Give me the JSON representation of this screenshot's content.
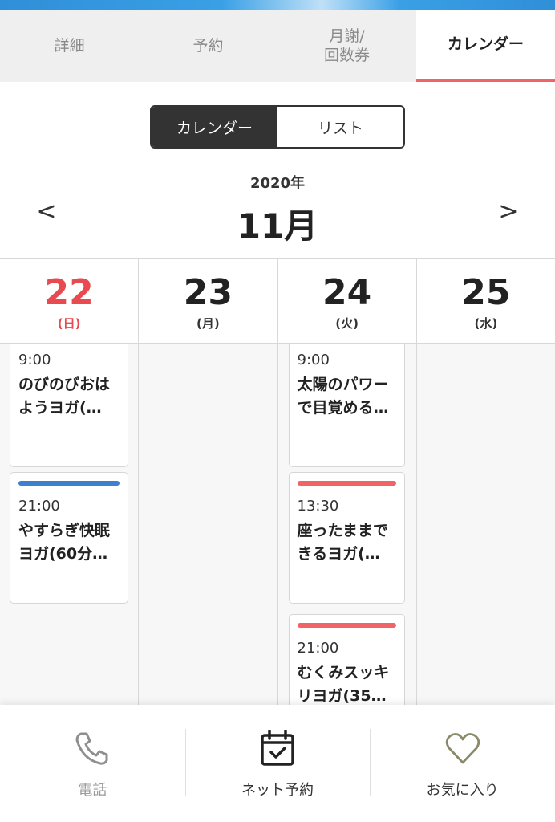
{
  "tabs": [
    {
      "line1": "詳細",
      "line2": ""
    },
    {
      "line1": "予約",
      "line2": ""
    },
    {
      "line1": "月謝/",
      "line2": "回数券"
    },
    {
      "line1": "カレンダー",
      "line2": ""
    }
  ],
  "view_toggle": {
    "calendar": "カレンダー",
    "list": "リスト"
  },
  "calendar": {
    "year": "2020年",
    "month": "11月",
    "prev": "<",
    "next": ">",
    "days": [
      {
        "num": "22",
        "weekday": "(日)"
      },
      {
        "num": "23",
        "weekday": "(月)"
      },
      {
        "num": "24",
        "weekday": "(火)"
      },
      {
        "num": "25",
        "weekday": "(水)"
      }
    ],
    "events": {
      "day22": [
        {
          "time": "9:00",
          "name": "のびのびおはようヨガ(…"
        },
        {
          "time": "21:00",
          "name": "やすらぎ快眠ヨガ(60分…",
          "bar_color": "#3f7fcf"
        }
      ],
      "day24": [
        {
          "time": "9:00",
          "name": "太陽のパワーで目覚める…"
        },
        {
          "time": "13:30",
          "name": "座ったままできるヨガ(…",
          "bar_color": "#f06468"
        },
        {
          "time": "21:00",
          "name": "むくみスッキリヨガ(35…",
          "bar_color": "#f06468"
        }
      ]
    }
  },
  "bottom_nav": {
    "phone": "電話",
    "booking": "ネット予約",
    "favorite": "お気に入り"
  },
  "colors": {
    "accent": "#f06468",
    "sunday": "#e84a4f",
    "blue_bar": "#3f7fcf"
  }
}
